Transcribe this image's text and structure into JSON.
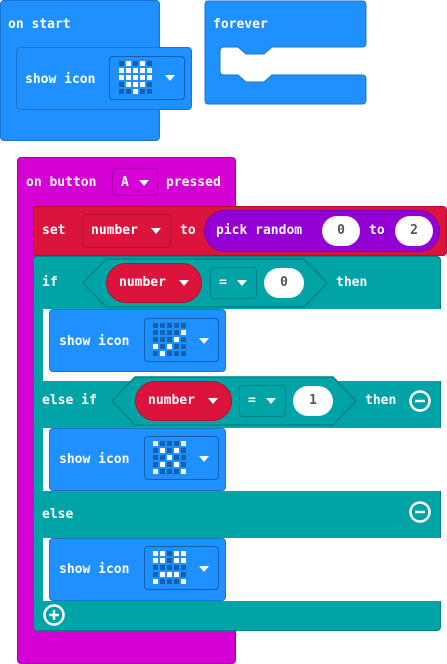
{
  "on_start": {
    "label": "on start",
    "show_icon_label": "show icon",
    "icon": "heart"
  },
  "forever": {
    "label": "forever"
  },
  "on_button": {
    "prefix": "on button",
    "button": "A",
    "suffix": "pressed"
  },
  "set_block": {
    "set": "set",
    "variable": "number",
    "to": "to"
  },
  "pick_random": {
    "label": "pick random",
    "min": "0",
    "to": "to",
    "max": "2"
  },
  "if_block": {
    "if_label": "if",
    "then_label": "then",
    "else_if_label": "else if",
    "else_label": "else",
    "cond1": {
      "variable": "number",
      "op": "=",
      "value": "0"
    },
    "cond2": {
      "variable": "number",
      "op": "=",
      "value": "1"
    }
  },
  "show_icons": {
    "label": "show icon",
    "icon1": "check",
    "icon2": "x",
    "icon3": "face"
  },
  "colors": {
    "basic": "#1e90ff",
    "input": "#d400d4",
    "variable": "#dc143c",
    "logic": "#00a4a6",
    "math": "#9400d3"
  }
}
